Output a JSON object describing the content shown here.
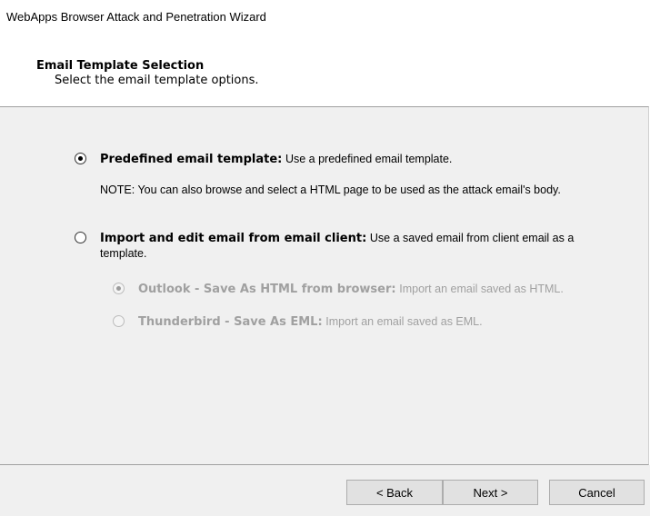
{
  "window": {
    "title": "WebApps Browser Attack and Penetration Wizard"
  },
  "header": {
    "title": "Email Template Selection",
    "subtitle": "Select the email template options."
  },
  "options": [
    {
      "id": "predefined",
      "label": "Predefined email template:",
      "description": "Use a predefined email template.",
      "checked": true,
      "enabled": true,
      "note": "NOTE: You can also browse and select a HTML page to be used as the attack email's body."
    },
    {
      "id": "import",
      "label": "Import and edit email from email client:",
      "description": "Use a saved email from client email as a template.",
      "checked": false,
      "enabled": true,
      "suboptions": [
        {
          "id": "outlook",
          "label": "Outlook - Save As HTML from browser:",
          "description": "Import an email saved as HTML.",
          "checked": true,
          "enabled": false
        },
        {
          "id": "thunderbird",
          "label": "Thunderbird - Save As EML:",
          "description": "Import an email saved as EML.",
          "checked": false,
          "enabled": false
        }
      ]
    }
  ],
  "buttons": {
    "back": "< Back",
    "next": "Next >",
    "cancel": "Cancel"
  }
}
